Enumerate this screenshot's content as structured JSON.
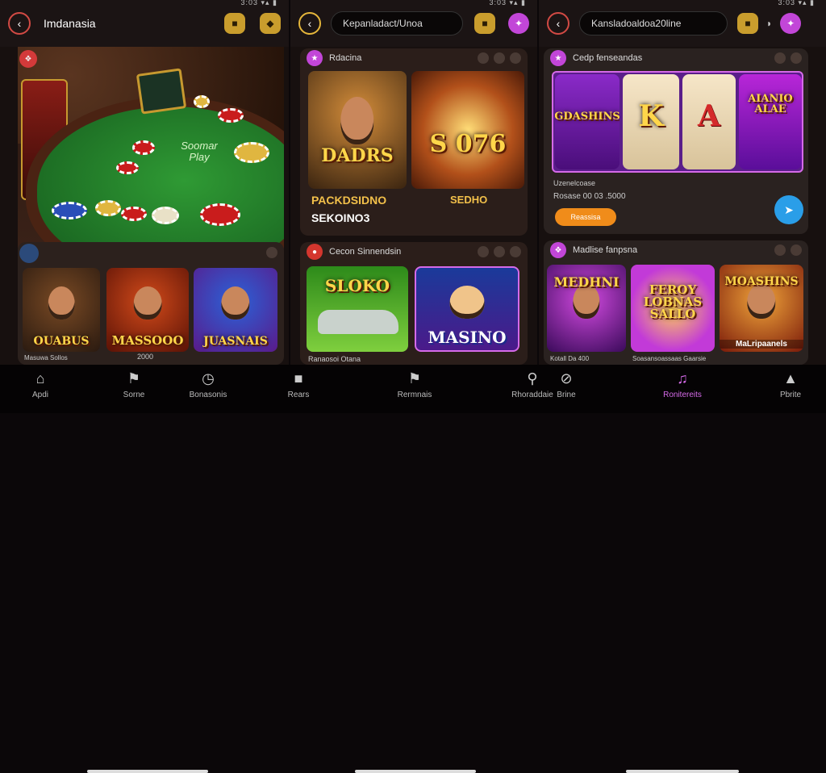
{
  "status": {
    "time": "3:03"
  },
  "panel1": {
    "title": "Imdanasia",
    "table_text": "Soomar Play",
    "game_caption_a": "Masuwa Sollos",
    "game_caption_b": "2000",
    "games": [
      {
        "title": "OUABUS"
      },
      {
        "title": "MASSOOO"
      },
      {
        "title": "JUASNAIS"
      }
    ]
  },
  "panel2": {
    "search_value": "Kepanladact/Unoa",
    "card1": {
      "title": "Rdacina",
      "tile1": "DADRS",
      "tile2": "S 076",
      "label_left": "PACKDSIDNO",
      "label_left2": "SEKOINO3",
      "label_right": "SEDHO"
    },
    "card2": {
      "title": "Cecon Sinnendsin",
      "tile1": "SLOKO",
      "tile2": "MASINO",
      "caption": "Ranaosoi Otana"
    }
  },
  "panel3": {
    "search_value": "Kansladoaldoa20line",
    "card1": {
      "title": "Cedp fenseandas",
      "reel1": "GDASHINS",
      "reel2": "K",
      "reel3": "A",
      "reel4": "AIANIO ALAE",
      "info1": "Uzenelcoase",
      "info2": "Rosase 00 03 .5000",
      "button": "Reassisa"
    },
    "card2": {
      "title": "Madlise fanpsna",
      "tile1": "MEDHNI",
      "tile2": "FEROY LOBNAS SALLO",
      "tile3": "MOASHINS",
      "tile3_sub": "MaLripaanels",
      "caption_a": "Kotall Da 400",
      "caption_b": "Soasansoassaas Gaarsie"
    }
  },
  "nav": [
    {
      "label": "Apdi",
      "icon": "home-icon"
    },
    {
      "label": "Sorne",
      "icon": "flag-icon"
    },
    {
      "label": "Bonasonis",
      "icon": "clock-icon"
    },
    {
      "label": "Rears",
      "icon": "lock-icon"
    },
    {
      "label": "Rermnais",
      "icon": "flag-icon"
    },
    {
      "label": "Rhoraddaie",
      "icon": "search-icon"
    },
    {
      "label": "Brine",
      "icon": "slash-icon"
    },
    {
      "label": "Ronitereits",
      "icon": "music-icon"
    },
    {
      "label": "Pbrite",
      "icon": "bell-icon"
    }
  ],
  "colors": {
    "accent": "#d56ae8",
    "gold": "#e5b63b",
    "felt": "#1f7a2a",
    "panel": "#17100f"
  }
}
